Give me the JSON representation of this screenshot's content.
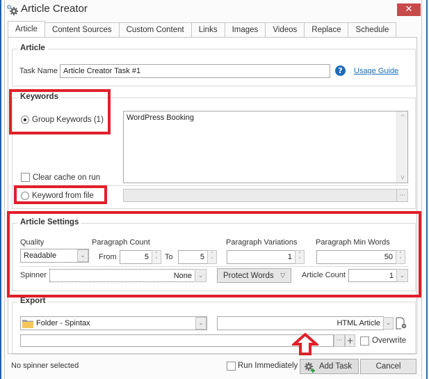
{
  "window": {
    "title": "Article Creator",
    "close_label": "✕",
    "icon": "gears-icon"
  },
  "tabs": [
    {
      "label": "Article",
      "active": true
    },
    {
      "label": "Content Sources",
      "active": false
    },
    {
      "label": "Custom Content",
      "active": false
    },
    {
      "label": "Links",
      "active": false
    },
    {
      "label": "Images",
      "active": false
    },
    {
      "label": "Videos",
      "active": false
    },
    {
      "label": "Replace",
      "active": false
    },
    {
      "label": "Schedule",
      "active": false
    }
  ],
  "article": {
    "group_label": "Article",
    "task_name_label": "Task Name",
    "task_name_value": "Article Creator Task #1",
    "help_icon": "question-circle-icon",
    "help_glyph": "?",
    "usage_guide_label": "Usage Guide"
  },
  "keywords": {
    "group_label": "Keywords",
    "group_keywords_label": "Group Keywords (1)",
    "group_keywords_selected": true,
    "keywords_text": "WordPress Booking",
    "clear_cache_label": "Clear cache on run",
    "clear_cache_checked": false,
    "keyword_from_file_label": "Keyword from file",
    "keyword_from_file_selected": false,
    "file_path_value": "",
    "browse_label": "···",
    "scroll_up": "^",
    "scroll_down": "v"
  },
  "article_settings": {
    "group_label": "Article Settings",
    "quality_label": "Quality",
    "quality_value": "Readable",
    "paragraph_count_label": "Paragraph Count",
    "from_label": "From",
    "from_value": "5",
    "to_label": "To",
    "to_value": "5",
    "paragraph_variations_label": "Paragraph Variations",
    "paragraph_variations_value": "1",
    "paragraph_min_words_label": "Paragraph Min Words",
    "paragraph_min_words_value": "50",
    "spinner_label": "Spinner",
    "spinner_value": "None",
    "protect_words_label": "Protect Words",
    "article_count_label": "Article Count",
    "article_count_value": "1",
    "spin_up": "˄",
    "spin_down": "˅",
    "dropdown_glyph": "⌄",
    "protect_glyph": "▽"
  },
  "export": {
    "group_label": "Export",
    "destination_value": "Folder - Spintax",
    "format_value": "HTML Article",
    "path_value": "",
    "browse_label": "···",
    "add_label": "+",
    "overwrite_label": "Overwrite",
    "overwrite_checked": false
  },
  "footer": {
    "status_text": "No spinner selected",
    "run_immediately_label": "Run Immediately",
    "run_immediately_checked": false,
    "add_task_label": "Add Task",
    "cancel_label": "Cancel"
  },
  "annotations": {
    "highlight_color": "#e0202a"
  }
}
